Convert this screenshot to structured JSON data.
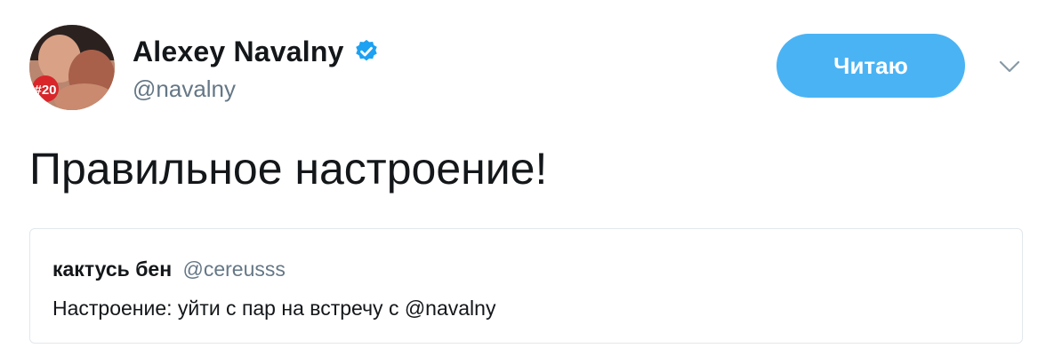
{
  "author": {
    "name": "Alexey Navalny",
    "handle": "@navalny",
    "verified": true,
    "avatar_badge": "#20"
  },
  "follow_button": {
    "label": "Читаю",
    "color": "#4ab3f4"
  },
  "menu_icon": "chevron-down-icon",
  "tweet": {
    "text": "Правильное настроение!"
  },
  "quoted_tweet": {
    "author_name": "кактусь бен",
    "author_handle": "@cereusss",
    "text": "Настроение: уйти с пар на встречу с @navalny"
  },
  "colors": {
    "text": "#14171a",
    "secondary": "#657786",
    "verified": "#1da1f2",
    "border": "#e1e8ed"
  }
}
